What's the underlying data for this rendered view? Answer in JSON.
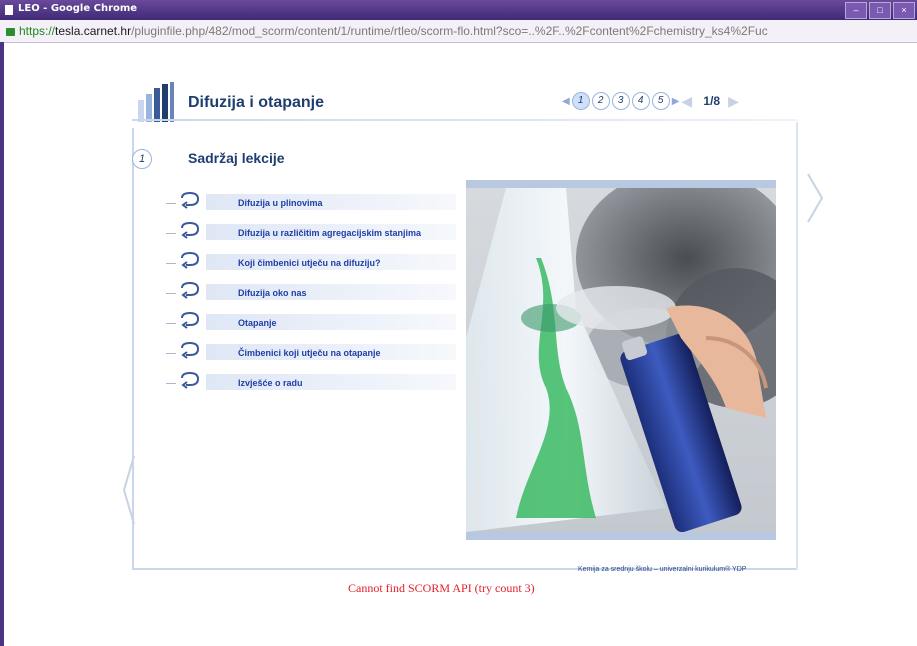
{
  "window": {
    "title": "LEO - Google Chrome",
    "controls": [
      "–",
      "□",
      "×"
    ]
  },
  "address_bar": {
    "scheme": "https://",
    "host": "tesla.carnet.hr",
    "path": "/pluginfile.php/482/mod_scorm/content/1/runtime/rtleo/scorm-flo.html?sco=..%2F..%2Fcontent%2Fchemistry_ks4%2Fuc"
  },
  "lesson": {
    "title": "Difuzija i otapanje",
    "pager": {
      "pages": [
        "1",
        "2",
        "3",
        "4",
        "5"
      ],
      "active": "1",
      "counter": "1/8"
    },
    "section": {
      "number": "1",
      "title": "Sadržaj lekcije"
    },
    "menu": [
      {
        "label": "Difuzija u plinovima"
      },
      {
        "label": "Difuzija u različitim agregacijskim stanjima"
      },
      {
        "label": "Koji čimbenici utječu na difuziju?"
      },
      {
        "label": "Difuzija oko nas"
      },
      {
        "label": "Otapanje"
      },
      {
        "label": "Čimbenici koji utječu na otapanje"
      },
      {
        "label": "Izvješće o radu"
      }
    ],
    "footer": "Kemija za srednju školu – univerzalni kurikulum® YDP"
  },
  "status": {
    "error": "Cannot find SCORM API (try count 3)"
  },
  "colors": {
    "titlebar": "#4a3585",
    "heading": "#1f3e70",
    "link": "#1f3ea8",
    "error": "#e0202a"
  },
  "icons": {
    "menu_item": "loop-arrow-icon",
    "lock": "padlock-icon"
  }
}
